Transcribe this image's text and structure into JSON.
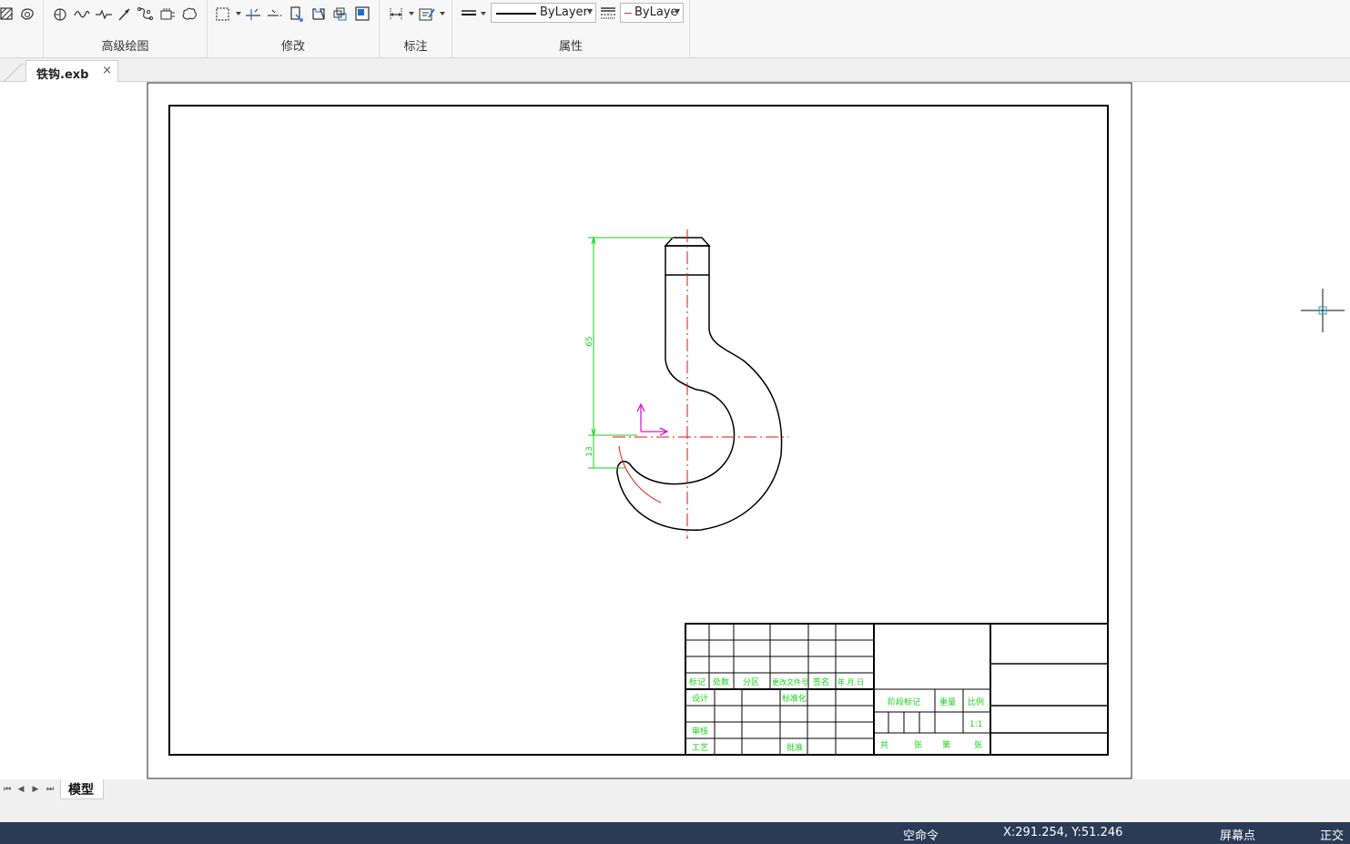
{
  "ribbon": {
    "groups": {
      "advanced_draw": "高级绘图",
      "modify": "修改",
      "dimension": "标注",
      "properties": "属性"
    },
    "linetype_combo": "ByLayer",
    "color_combo": "ByLaye"
  },
  "tabs": {
    "document": "铁钩.exb",
    "close": "×"
  },
  "drawing": {
    "dims": {
      "d65": "65",
      "d13": "13"
    },
    "title_block": {
      "mark": "标记",
      "count": "处数",
      "zone": "分区",
      "change_doc": "更改文件号",
      "sign": "签名",
      "date": "年.月.日",
      "design": "设计",
      "standardize": "标准化",
      "review": "审核",
      "process": "工艺",
      "approve": "批准",
      "stage_mark": "阶段标记",
      "weight": "重量",
      "scale": "比例",
      "scale_value": "1:1",
      "total": "共",
      "sheets": "张",
      "no": "第",
      "sheet": "张"
    }
  },
  "layout_tabs": {
    "nav": [
      "⏮",
      "◀",
      "▶",
      "⏭"
    ],
    "model": "模型"
  },
  "status": {
    "command": "空命令",
    "coords": "X:291.254, Y:51.246",
    "snap": "屏幕点",
    "ortho": "正交"
  }
}
